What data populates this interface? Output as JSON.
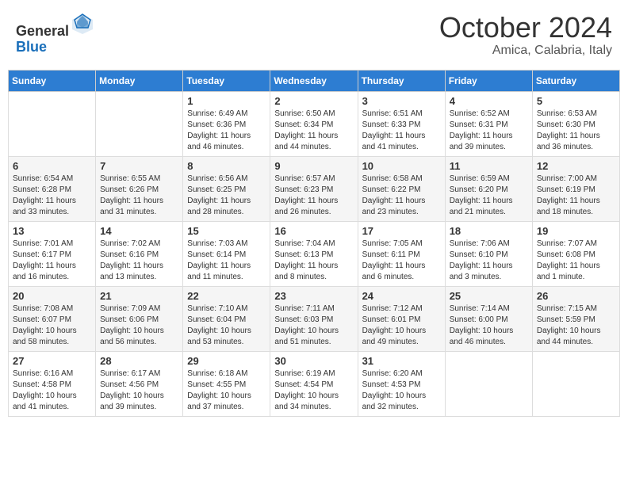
{
  "header": {
    "logo_general": "General",
    "logo_blue": "Blue",
    "month": "October 2024",
    "location": "Amica, Calabria, Italy"
  },
  "days_of_week": [
    "Sunday",
    "Monday",
    "Tuesday",
    "Wednesday",
    "Thursday",
    "Friday",
    "Saturday"
  ],
  "weeks": [
    [
      {
        "day": "",
        "info": ""
      },
      {
        "day": "",
        "info": ""
      },
      {
        "day": "1",
        "info": "Sunrise: 6:49 AM\nSunset: 6:36 PM\nDaylight: 11 hours and 46 minutes."
      },
      {
        "day": "2",
        "info": "Sunrise: 6:50 AM\nSunset: 6:34 PM\nDaylight: 11 hours and 44 minutes."
      },
      {
        "day": "3",
        "info": "Sunrise: 6:51 AM\nSunset: 6:33 PM\nDaylight: 11 hours and 41 minutes."
      },
      {
        "day": "4",
        "info": "Sunrise: 6:52 AM\nSunset: 6:31 PM\nDaylight: 11 hours and 39 minutes."
      },
      {
        "day": "5",
        "info": "Sunrise: 6:53 AM\nSunset: 6:30 PM\nDaylight: 11 hours and 36 minutes."
      }
    ],
    [
      {
        "day": "6",
        "info": "Sunrise: 6:54 AM\nSunset: 6:28 PM\nDaylight: 11 hours and 33 minutes."
      },
      {
        "day": "7",
        "info": "Sunrise: 6:55 AM\nSunset: 6:26 PM\nDaylight: 11 hours and 31 minutes."
      },
      {
        "day": "8",
        "info": "Sunrise: 6:56 AM\nSunset: 6:25 PM\nDaylight: 11 hours and 28 minutes."
      },
      {
        "day": "9",
        "info": "Sunrise: 6:57 AM\nSunset: 6:23 PM\nDaylight: 11 hours and 26 minutes."
      },
      {
        "day": "10",
        "info": "Sunrise: 6:58 AM\nSunset: 6:22 PM\nDaylight: 11 hours and 23 minutes."
      },
      {
        "day": "11",
        "info": "Sunrise: 6:59 AM\nSunset: 6:20 PM\nDaylight: 11 hours and 21 minutes."
      },
      {
        "day": "12",
        "info": "Sunrise: 7:00 AM\nSunset: 6:19 PM\nDaylight: 11 hours and 18 minutes."
      }
    ],
    [
      {
        "day": "13",
        "info": "Sunrise: 7:01 AM\nSunset: 6:17 PM\nDaylight: 11 hours and 16 minutes."
      },
      {
        "day": "14",
        "info": "Sunrise: 7:02 AM\nSunset: 6:16 PM\nDaylight: 11 hours and 13 minutes."
      },
      {
        "day": "15",
        "info": "Sunrise: 7:03 AM\nSunset: 6:14 PM\nDaylight: 11 hours and 11 minutes."
      },
      {
        "day": "16",
        "info": "Sunrise: 7:04 AM\nSunset: 6:13 PM\nDaylight: 11 hours and 8 minutes."
      },
      {
        "day": "17",
        "info": "Sunrise: 7:05 AM\nSunset: 6:11 PM\nDaylight: 11 hours and 6 minutes."
      },
      {
        "day": "18",
        "info": "Sunrise: 7:06 AM\nSunset: 6:10 PM\nDaylight: 11 hours and 3 minutes."
      },
      {
        "day": "19",
        "info": "Sunrise: 7:07 AM\nSunset: 6:08 PM\nDaylight: 11 hours and 1 minute."
      }
    ],
    [
      {
        "day": "20",
        "info": "Sunrise: 7:08 AM\nSunset: 6:07 PM\nDaylight: 10 hours and 58 minutes."
      },
      {
        "day": "21",
        "info": "Sunrise: 7:09 AM\nSunset: 6:06 PM\nDaylight: 10 hours and 56 minutes."
      },
      {
        "day": "22",
        "info": "Sunrise: 7:10 AM\nSunset: 6:04 PM\nDaylight: 10 hours and 53 minutes."
      },
      {
        "day": "23",
        "info": "Sunrise: 7:11 AM\nSunset: 6:03 PM\nDaylight: 10 hours and 51 minutes."
      },
      {
        "day": "24",
        "info": "Sunrise: 7:12 AM\nSunset: 6:01 PM\nDaylight: 10 hours and 49 minutes."
      },
      {
        "day": "25",
        "info": "Sunrise: 7:14 AM\nSunset: 6:00 PM\nDaylight: 10 hours and 46 minutes."
      },
      {
        "day": "26",
        "info": "Sunrise: 7:15 AM\nSunset: 5:59 PM\nDaylight: 10 hours and 44 minutes."
      }
    ],
    [
      {
        "day": "27",
        "info": "Sunrise: 6:16 AM\nSunset: 4:58 PM\nDaylight: 10 hours and 41 minutes."
      },
      {
        "day": "28",
        "info": "Sunrise: 6:17 AM\nSunset: 4:56 PM\nDaylight: 10 hours and 39 minutes."
      },
      {
        "day": "29",
        "info": "Sunrise: 6:18 AM\nSunset: 4:55 PM\nDaylight: 10 hours and 37 minutes."
      },
      {
        "day": "30",
        "info": "Sunrise: 6:19 AM\nSunset: 4:54 PM\nDaylight: 10 hours and 34 minutes."
      },
      {
        "day": "31",
        "info": "Sunrise: 6:20 AM\nSunset: 4:53 PM\nDaylight: 10 hours and 32 minutes."
      },
      {
        "day": "",
        "info": ""
      },
      {
        "day": "",
        "info": ""
      }
    ]
  ]
}
